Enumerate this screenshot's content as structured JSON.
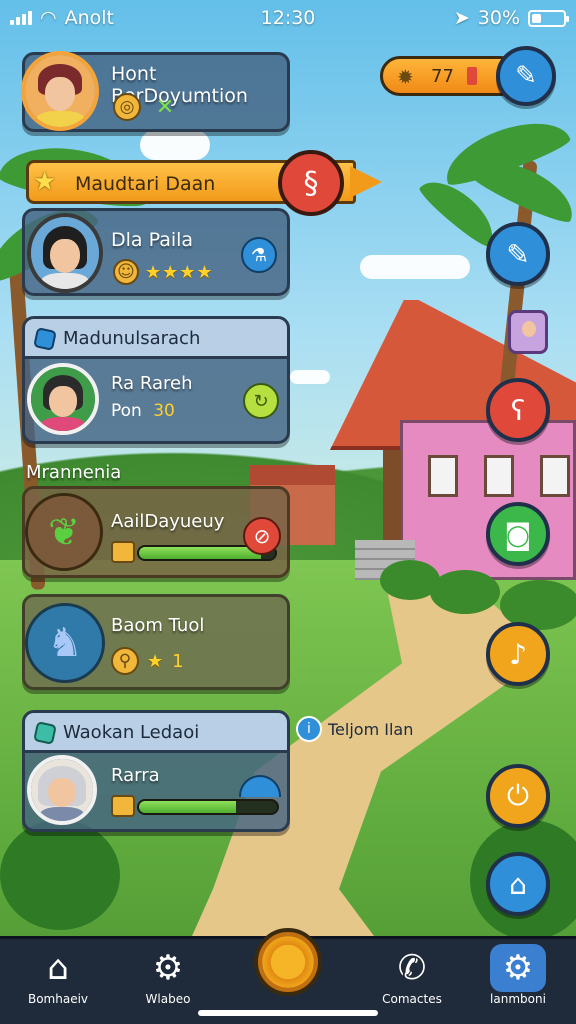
{
  "status_bar": {
    "carrier": "Anolt",
    "time": "12:30",
    "battery_percent": "30%",
    "battery_level": 0.3
  },
  "profile": {
    "name": "Hont BorDoyumtion",
    "icons": [
      "coin-icon",
      "sparkle-icon"
    ]
  },
  "currency": {
    "value": "77",
    "icon": "gear-coin-icon"
  },
  "quest_banner": {
    "label": "Maudtari Daan"
  },
  "friend_card": {
    "name": "Dla Paila",
    "rating_stars": 4,
    "stars_text": "★★★★"
  },
  "member_card": {
    "header": "Madunulsarach",
    "name": "Ra Rareh",
    "sub": "Pon",
    "count": "30"
  },
  "section_label": "Mrannenia",
  "task_cards": [
    {
      "title": "AailDayueuy",
      "progress": 0.9
    },
    {
      "title": "Baom Tuol",
      "count": "1"
    }
  ],
  "bottom_card": {
    "header": "Waokan Ledaoi",
    "name": "Rarra",
    "progress": 0.7
  },
  "tag": {
    "label": "Teljom Ilan"
  },
  "nav": {
    "items": [
      {
        "label": "Bomhaeiv",
        "icon": "home-icon"
      },
      {
        "label": "Wlabeo",
        "icon": "gear-icon"
      },
      {
        "label": "Comactes",
        "icon": "phone-icon"
      },
      {
        "label": "lanmboni",
        "icon": "settings-icon"
      }
    ]
  },
  "colors": {
    "accent_orange": "#f0a51c",
    "accent_blue": "#3a7fd0",
    "accent_green": "#4fae2f",
    "accent_red": "#e0483a"
  }
}
